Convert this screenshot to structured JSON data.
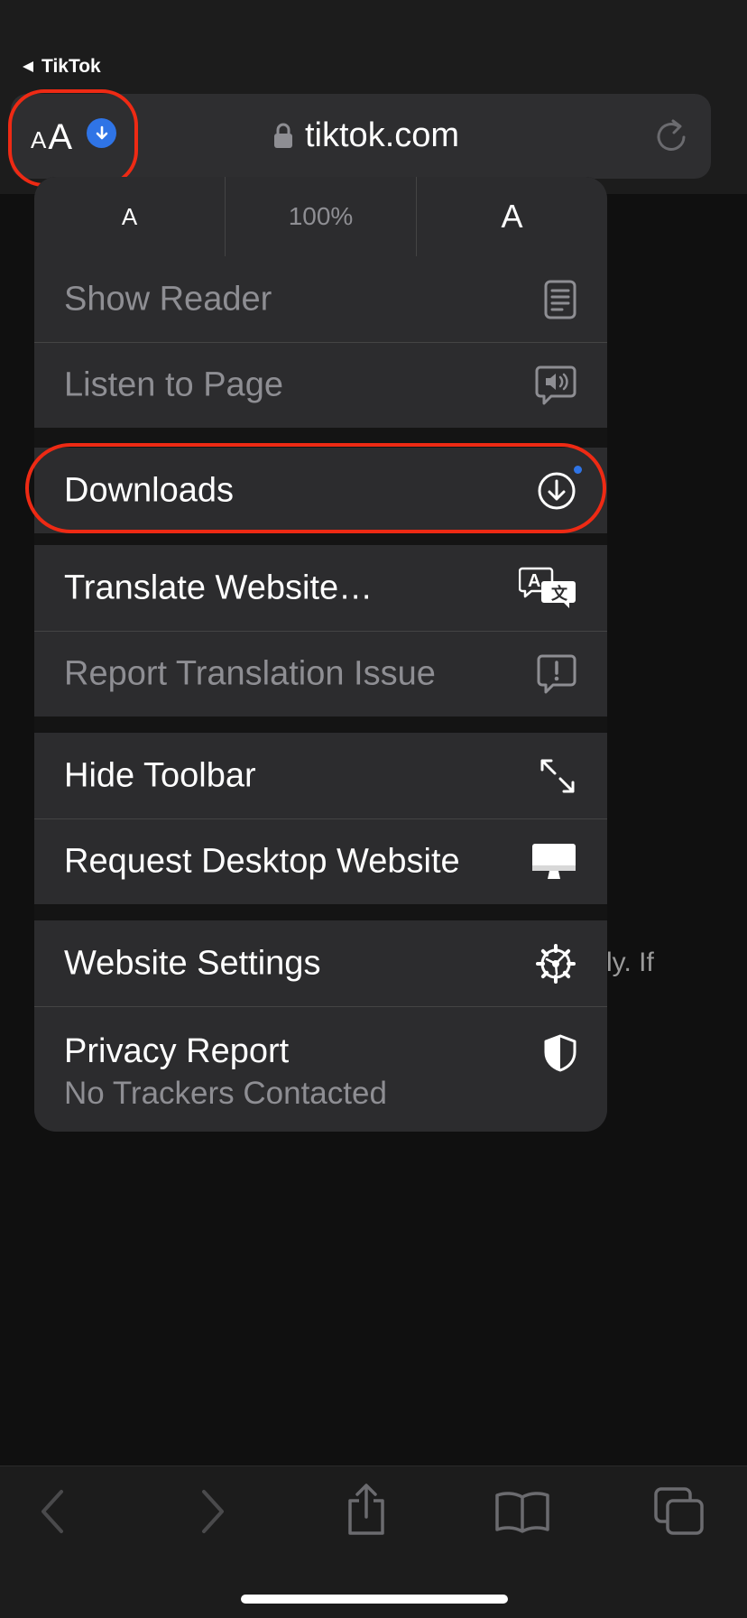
{
  "status": {
    "back_app": "TikTok"
  },
  "url_bar": {
    "text_size_small": "A",
    "text_size_big": "A",
    "domain": "tiktok.com"
  },
  "menu": {
    "zoom": {
      "decrease": "A",
      "level": "100%",
      "increase": "A"
    },
    "items": [
      {
        "label": "Show Reader",
        "icon": "reader-icon",
        "enabled": false
      },
      {
        "label": "Listen to Page",
        "icon": "speaker-bubble-icon",
        "enabled": false
      },
      {
        "label": "Downloads",
        "icon": "download-circle-icon",
        "enabled": true
      },
      {
        "label": "Translate Website…",
        "icon": "translate-icon",
        "enabled": true
      },
      {
        "label": "Report Translation Issue",
        "icon": "exclamation-bubble-icon",
        "enabled": false
      },
      {
        "label": "Hide Toolbar",
        "icon": "expand-arrows-icon",
        "enabled": true
      },
      {
        "label": "Request Desktop Website",
        "icon": "desktop-icon",
        "enabled": true
      },
      {
        "label": "Website Settings",
        "icon": "gear-icon",
        "enabled": true
      },
      {
        "label": "Privacy Report",
        "sublabel": "No Trackers Contacted",
        "icon": "shield-icon",
        "enabled": true
      }
    ]
  },
  "background": {
    "fragment_text": "ly. If"
  },
  "colors": {
    "accent": "#2f74e6",
    "highlight": "#ee2a14",
    "menu_bg": "#2c2c2e",
    "dim_text": "#8e8e93"
  }
}
